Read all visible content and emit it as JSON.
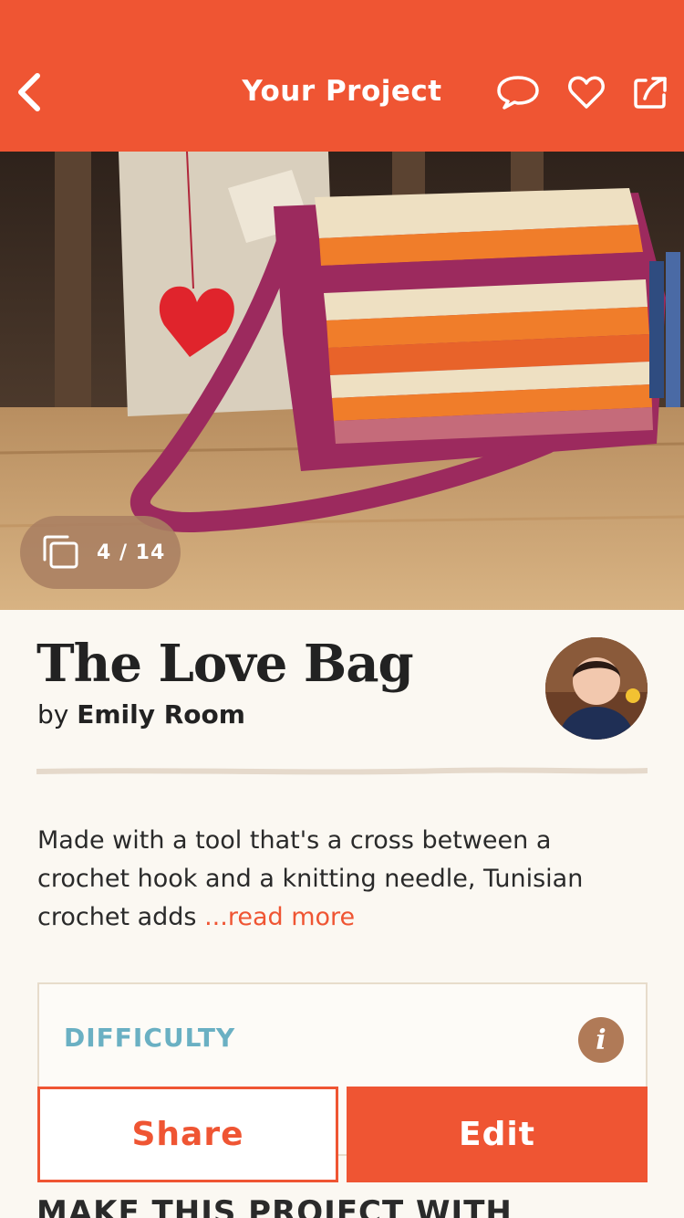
{
  "header": {
    "title": "Your Project",
    "icons": [
      "back-chevron-icon",
      "comment-icon",
      "heart-icon",
      "share-out-icon"
    ]
  },
  "hero": {
    "counter": "4 / 14",
    "counter_icon": "gallery-stack-icon"
  },
  "project": {
    "title": "The Love Bag",
    "by": "by",
    "author": "Emily Room",
    "description": "Made with a tool that's a cross between a crochet hook and a knitting needle, Tunisian crochet adds ",
    "read_more": "...read more"
  },
  "difficulty": {
    "label": "DIFFICULTY",
    "info": "i"
  },
  "actions": {
    "share": "Share",
    "edit": "Edit"
  },
  "section": {
    "make_with": "MAKE THIS PROJECT WITH"
  },
  "colors": {
    "accent": "#ef5533",
    "difficulty_label": "#6ab0c3",
    "info_badge": "#b07a57",
    "background": "#fbf8f2"
  }
}
